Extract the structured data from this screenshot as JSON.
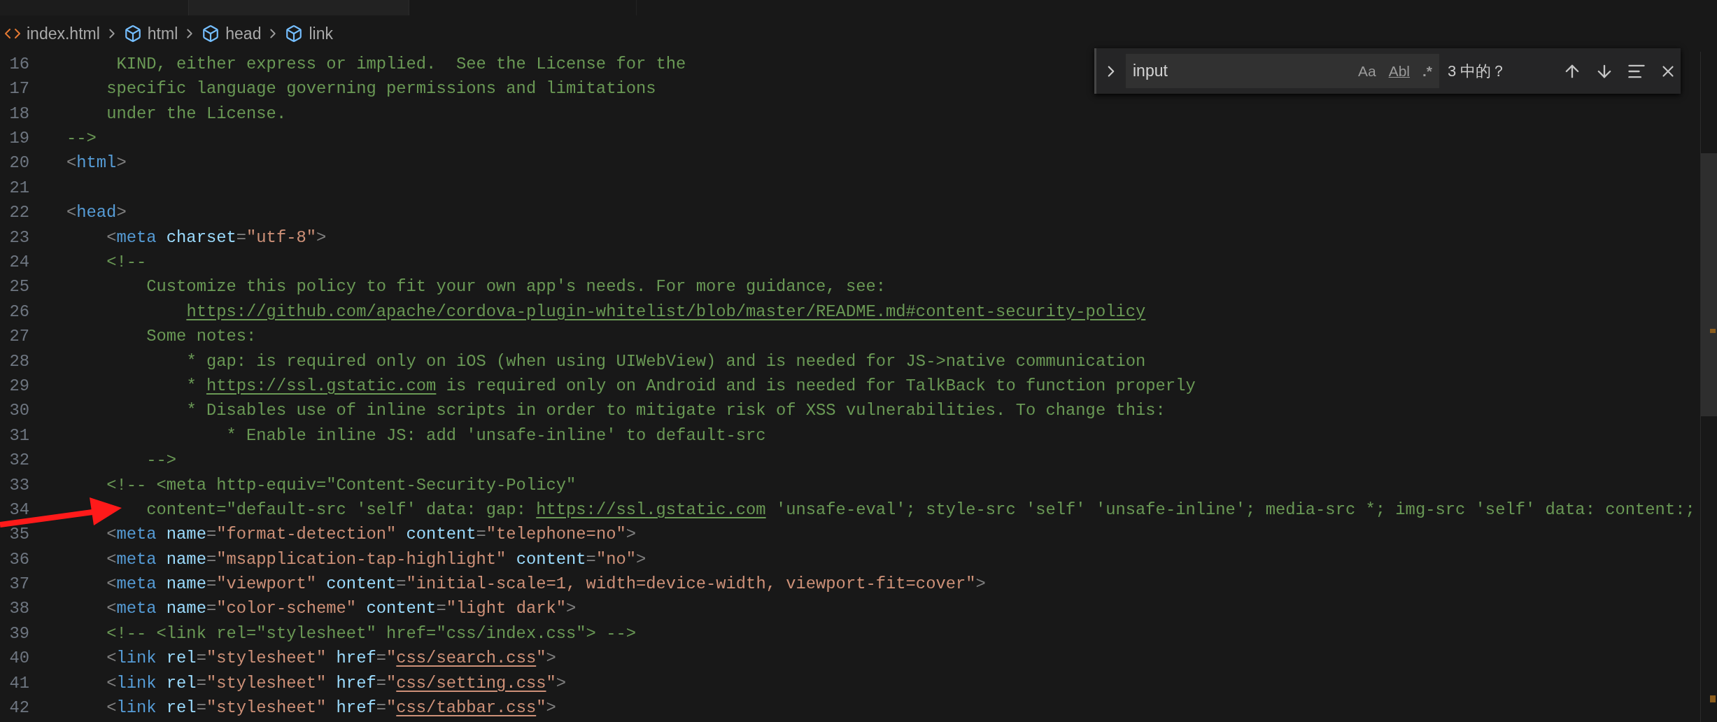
{
  "breadcrumbs": [
    {
      "kind": "file",
      "label": "index.html"
    },
    {
      "kind": "element",
      "label": "html"
    },
    {
      "kind": "element",
      "label": "head"
    },
    {
      "kind": "element",
      "label": "link"
    }
  ],
  "find_widget": {
    "expanded": false,
    "value": "input",
    "options": [
      {
        "kind": "case",
        "label": "Aa",
        "selected": false
      },
      {
        "kind": "word",
        "label": "Abl",
        "selected": false
      },
      {
        "kind": "regex",
        "label": ".*",
        "selected": false
      }
    ],
    "result": "3 中的？"
  },
  "editor": {
    "lines": [
      {
        "number": "16",
        "tokens": [
          {
            "kind": "comment",
            "text": "     KIND, either express or implied.  See the License for the"
          }
        ]
      },
      {
        "number": "17",
        "tokens": [
          {
            "kind": "comment",
            "text": "    specific language governing permissions and limitations"
          }
        ]
      },
      {
        "number": "18",
        "tokens": [
          {
            "kind": "comment",
            "text": "    under the License."
          }
        ]
      },
      {
        "number": "19",
        "tokens": [
          {
            "kind": "comment",
            "text": "-->"
          }
        ]
      },
      {
        "number": "20",
        "tokens": [
          {
            "kind": "punct",
            "text": "<"
          },
          {
            "kind": "tag",
            "text": "html"
          },
          {
            "kind": "punct",
            "text": ">"
          }
        ]
      },
      {
        "number": "21"
      },
      {
        "number": "22",
        "tokens": [
          {
            "kind": "punct",
            "text": "<"
          },
          {
            "kind": "tag",
            "text": "head"
          },
          {
            "kind": "punct",
            "text": ">"
          }
        ]
      },
      {
        "number": "23",
        "tokens": [
          {
            "kind": "punct",
            "text": "    <"
          },
          {
            "kind": "tag",
            "text": "meta"
          },
          {
            "kind": "attr",
            "text": " charset"
          },
          {
            "kind": "punct",
            "text": "="
          },
          {
            "kind": "string",
            "text": "\"utf-8\""
          },
          {
            "kind": "punct",
            "text": ">"
          }
        ]
      },
      {
        "number": "24",
        "tokens": [
          {
            "kind": "comment",
            "text": "    <!--"
          }
        ]
      },
      {
        "number": "25",
        "tokens": [
          {
            "kind": "comment",
            "text": "        Customize this policy to fit your own app's needs. For more guidance, see:"
          }
        ]
      },
      {
        "number": "26",
        "tokens": [
          {
            "kind": "comment_link",
            "text": "            https://github.com/apache/cordova-plugin-whitelist/blob/master/README.md#content-security-policy"
          }
        ]
      },
      {
        "number": "27",
        "tokens": [
          {
            "kind": "comment",
            "text": "        Some notes:"
          }
        ]
      },
      {
        "number": "28",
        "tokens": [
          {
            "kind": "comment",
            "text": "            * gap: is required only on iOS (when using UIWebView) and is needed for JS->native communication"
          }
        ]
      },
      {
        "number": "29",
        "tokens": [
          {
            "kind": "comment",
            "text": "            * "
          },
          {
            "kind": "comment_link",
            "text": "https://ssl.gstatic.com"
          },
          {
            "kind": "comment",
            "text": " is required only on Android and is needed for TalkBack to function properly"
          }
        ]
      },
      {
        "number": "30",
        "tokens": [
          {
            "kind": "comment",
            "text": "            * Disables use of inline scripts in order to mitigate risk of XSS vulnerabilities. To change this:"
          }
        ]
      },
      {
        "number": "31",
        "tokens": [
          {
            "kind": "comment",
            "text": "                * Enable inline JS: add 'unsafe-inline' to default-src"
          }
        ]
      },
      {
        "number": "32",
        "tokens": [
          {
            "kind": "comment",
            "text": "        -->"
          }
        ]
      },
      {
        "number": "33",
        "tokens": [
          {
            "kind": "comment",
            "text": "    <!-- <meta http-equiv=\"Content-Security-Policy\""
          }
        ]
      },
      {
        "number": "34",
        "tokens": [
          {
            "kind": "comment",
            "text": "        content=\"default-src 'self' data: gap: "
          },
          {
            "kind": "comment_link",
            "text": "https://ssl.gstatic.com"
          },
          {
            "kind": "comment",
            "text": " 'unsafe-eval'; style-src 'self' 'unsafe-inline'; media-src *; img-src 'self' data: content:;"
          }
        ]
      },
      {
        "number": "35",
        "tokens": [
          {
            "kind": "punct",
            "text": "    <"
          },
          {
            "kind": "tag",
            "text": "meta"
          },
          {
            "kind": "attr",
            "text": " name"
          },
          {
            "kind": "punct",
            "text": "="
          },
          {
            "kind": "string",
            "text": "\"format-detection\""
          },
          {
            "kind": "attr",
            "text": " content"
          },
          {
            "kind": "punct",
            "text": "="
          },
          {
            "kind": "string",
            "text": "\"telephone=no\""
          },
          {
            "kind": "punct",
            "text": ">"
          }
        ]
      },
      {
        "number": "36",
        "tokens": [
          {
            "kind": "punct",
            "text": "    <"
          },
          {
            "kind": "tag",
            "text": "meta"
          },
          {
            "kind": "attr",
            "text": " name"
          },
          {
            "kind": "punct",
            "text": "="
          },
          {
            "kind": "string",
            "text": "\"msapplication-tap-highlight\""
          },
          {
            "kind": "attr",
            "text": " content"
          },
          {
            "kind": "punct",
            "text": "="
          },
          {
            "kind": "string",
            "text": "\"no\""
          },
          {
            "kind": "punct",
            "text": ">"
          }
        ]
      },
      {
        "number": "37",
        "tokens": [
          {
            "kind": "punct",
            "text": "    <"
          },
          {
            "kind": "tag",
            "text": "meta"
          },
          {
            "kind": "attr",
            "text": " name"
          },
          {
            "kind": "punct",
            "text": "="
          },
          {
            "kind": "string",
            "text": "\"viewport\""
          },
          {
            "kind": "attr",
            "text": " content"
          },
          {
            "kind": "punct",
            "text": "="
          },
          {
            "kind": "string",
            "text": "\"initial-scale=1, width=device-width, viewport-fit=cover\""
          },
          {
            "kind": "punct",
            "text": ">"
          }
        ]
      },
      {
        "number": "38",
        "tokens": [
          {
            "kind": "punct",
            "text": "    <"
          },
          {
            "kind": "tag",
            "text": "meta"
          },
          {
            "kind": "attr",
            "text": " name"
          },
          {
            "kind": "punct",
            "text": "="
          },
          {
            "kind": "string",
            "text": "\"color-scheme\""
          },
          {
            "kind": "attr",
            "text": " content"
          },
          {
            "kind": "punct",
            "text": "="
          },
          {
            "kind": "string",
            "text": "\"light dark\""
          },
          {
            "kind": "punct",
            "text": ">"
          }
        ]
      },
      {
        "number": "39",
        "tokens": [
          {
            "kind": "comment",
            "text": "    <!-- <link rel=\"stylesheet\" href=\"css/index.css\"> -->"
          }
        ]
      },
      {
        "number": "40",
        "tokens": [
          {
            "kind": "punct",
            "text": "    <"
          },
          {
            "kind": "tag",
            "text": "link"
          },
          {
            "kind": "attr",
            "text": " rel"
          },
          {
            "kind": "punct",
            "text": "="
          },
          {
            "kind": "string",
            "text": "\"stylesheet\""
          },
          {
            "kind": "attr",
            "text": " href"
          },
          {
            "kind": "punct",
            "text": "="
          },
          {
            "kind": "string",
            "text": "\""
          },
          {
            "kind": "string_link",
            "text": "css/search.css"
          },
          {
            "kind": "string",
            "text": "\""
          },
          {
            "kind": "punct",
            "text": ">"
          }
        ]
      },
      {
        "number": "41",
        "tokens": [
          {
            "kind": "punct",
            "text": "    <"
          },
          {
            "kind": "tag",
            "text": "link"
          },
          {
            "kind": "attr",
            "text": " rel"
          },
          {
            "kind": "punct",
            "text": "="
          },
          {
            "kind": "string",
            "text": "\"stylesheet\""
          },
          {
            "kind": "attr",
            "text": " href"
          },
          {
            "kind": "punct",
            "text": "="
          },
          {
            "kind": "string",
            "text": "\""
          },
          {
            "kind": "string_link",
            "text": "css/setting.css"
          },
          {
            "kind": "string",
            "text": "\""
          },
          {
            "kind": "punct",
            "text": ">"
          }
        ]
      },
      {
        "number": "42",
        "tokens": [
          {
            "kind": "punct",
            "text": "    <"
          },
          {
            "kind": "tag",
            "text": "link"
          },
          {
            "kind": "attr",
            "text": " rel"
          },
          {
            "kind": "punct",
            "text": "="
          },
          {
            "kind": "string",
            "text": "\"stylesheet\""
          },
          {
            "kind": "attr",
            "text": " href"
          },
          {
            "kind": "punct",
            "text": "="
          },
          {
            "kind": "string",
            "text": "\""
          },
          {
            "kind": "string_link",
            "text": "css/tabbar.css"
          },
          {
            "kind": "string",
            "text": "\""
          },
          {
            "kind": "punct",
            "text": ">"
          }
        ]
      }
    ]
  }
}
